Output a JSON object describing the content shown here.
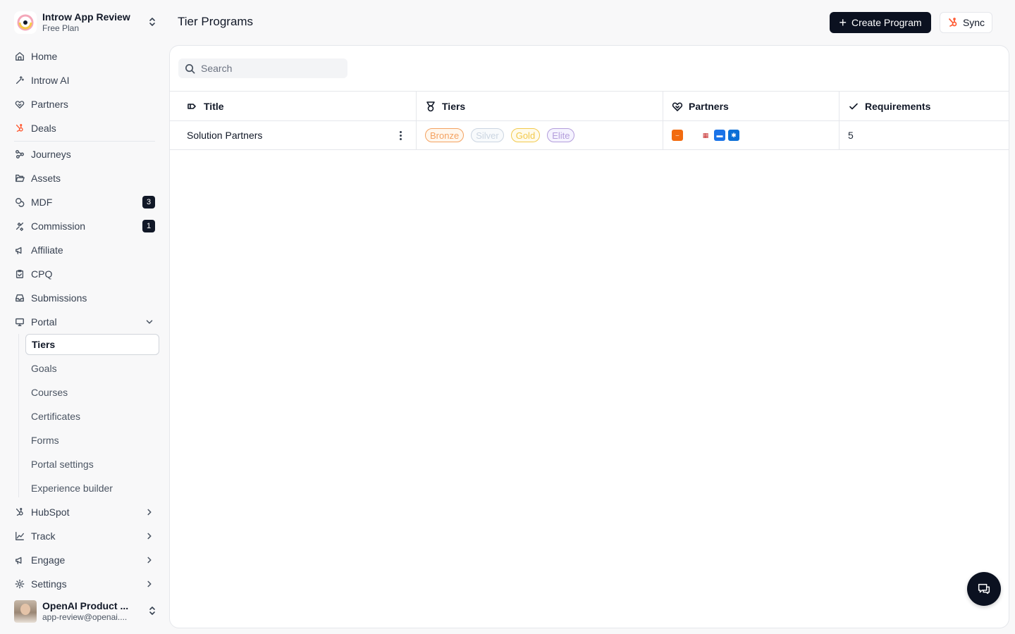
{
  "workspace": {
    "name": "Introw App Review",
    "plan": "Free Plan"
  },
  "nav": {
    "home": "Home",
    "ai": "Introw AI",
    "partners": "Partners",
    "deals": "Deals",
    "journeys": "Journeys",
    "assets": "Assets",
    "mdf": "MDF",
    "mdf_badge": "3",
    "commission": "Commission",
    "commission_badge": "1",
    "affiliate": "Affiliate",
    "cpq": "CPQ",
    "submissions": "Submissions",
    "portal": "Portal",
    "hubspot": "HubSpot",
    "track": "Track",
    "engage": "Engage",
    "settings": "Settings"
  },
  "portal_sub": {
    "tiers": "Tiers",
    "goals": "Goals",
    "courses": "Courses",
    "certificates": "Certificates",
    "forms": "Forms",
    "portal_settings": "Portal settings",
    "experience_builder": "Experience builder"
  },
  "user": {
    "name": "OpenAI Product ...",
    "email": "app-review@openai...."
  },
  "header": {
    "title": "Tier Programs",
    "create_label": "Create Program",
    "sync_label": "Sync"
  },
  "search": {
    "placeholder": "Search",
    "value": ""
  },
  "table": {
    "columns": {
      "title": "Title",
      "tiers": "Tiers",
      "partners": "Partners",
      "requirements": "Requirements"
    },
    "rows": [
      {
        "title": "Solution Partners",
        "tiers": [
          {
            "label": "Bronze",
            "color": "#f4a261",
            "bg": "#fff7ed"
          },
          {
            "label": "Silver",
            "color": "#cbd5e1",
            "bg": "#f8fafc"
          },
          {
            "label": "Gold",
            "color": "#f2c94c",
            "bg": "#fffbeb"
          },
          {
            "label": "Elite",
            "color": "#b39ddb",
            "bg": "#f5f3ff"
          }
        ],
        "partner_logos": [
          {
            "name": "amazon-logo",
            "bg": "#f26b0f",
            "glyph": "⌣"
          },
          {
            "name": "apple-logo",
            "bg": "#ffffff",
            "glyph": ""
          },
          {
            "name": "toys-logo",
            "bg": "#ffffff",
            "glyph": "▦"
          },
          {
            "name": "blue-logo",
            "bg": "#1a73e8",
            "glyph": "▬"
          },
          {
            "name": "walmart-logo",
            "bg": "#0b6fd6",
            "glyph": "✱"
          }
        ],
        "requirements": "5"
      }
    ]
  },
  "colors": {
    "accent": "#0b1120",
    "hubspot": "#ff5c35"
  }
}
